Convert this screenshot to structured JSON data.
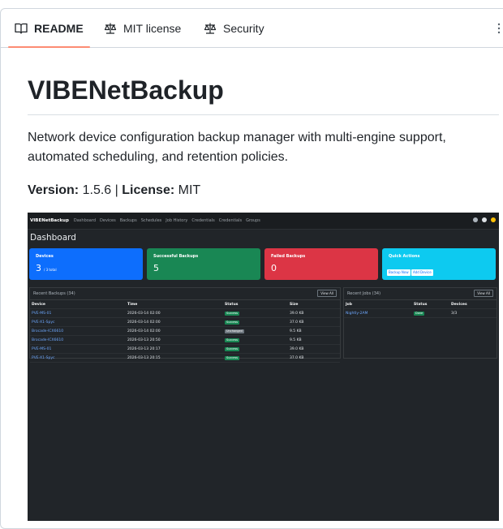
{
  "tabs": [
    {
      "label": "README",
      "icon": "book-icon",
      "active": true
    },
    {
      "label": "MIT license",
      "icon": "scale-icon",
      "active": false
    },
    {
      "label": "Security",
      "icon": "scale-icon",
      "active": false
    }
  ],
  "readme": {
    "title": "VIBENetBackup",
    "description": "Network device configuration backup manager with multi-engine support, automated scheduling, and retention policies.",
    "version_label": "Version:",
    "version": "1.5.6",
    "separator": "|",
    "license_label": "License:",
    "license": "MIT"
  },
  "screenshot": {
    "brand": "VIBENetBackup",
    "nav": [
      "Dashboard",
      "Devices",
      "Backups",
      "Schedules",
      "Job History",
      "Credentials",
      "Credentials",
      "Groups"
    ],
    "page_title": "Dashboard",
    "cards": [
      {
        "title": "Devices",
        "value": "3",
        "sub": "/ 3 total",
        "color": "#0d6efd"
      },
      {
        "title": "Successful Backups",
        "value": "5",
        "color": "#198754"
      },
      {
        "title": "Failed Backups",
        "value": "0",
        "color": "#dc3545"
      },
      {
        "title": "Quick Actions",
        "color": "#0dcaf0",
        "buttons": [
          "Backup Now",
          "Add Device"
        ]
      }
    ],
    "recent_backups": {
      "title": "Recent Backups (34)",
      "view_all": "View All",
      "columns": [
        "Device",
        "Time",
        "Status",
        "Size"
      ],
      "rows": [
        {
          "device": "PVE-MS-01",
          "time": "2026-03-14 02:00",
          "status": "Success",
          "status_color": "#198754",
          "size": "39.0 KB"
        },
        {
          "device": "PVE-X1-Spyc",
          "time": "2026-03-14 02:00",
          "status": "Success",
          "status_color": "#198754",
          "size": "37.0 KB"
        },
        {
          "device": "Brocade-ICX6610",
          "time": "2026-03-14 02:00",
          "status": "Unchanged",
          "status_color": "#6c757d",
          "size": "9.5 KB"
        },
        {
          "device": "Brocade-ICX6610",
          "time": "2026-03-13 20:50",
          "status": "Success",
          "status_color": "#198754",
          "size": "9.5 KB"
        },
        {
          "device": "PVE-MS-01",
          "time": "2026-03-13 20:17",
          "status": "Success",
          "status_color": "#198754",
          "size": "39.0 KB"
        },
        {
          "device": "PVE-X1-Spyc",
          "time": "2026-03-13 20:15",
          "status": "Success",
          "status_color": "#198754",
          "size": "37.0 KB"
        }
      ]
    },
    "recent_jobs": {
      "title": "Recent Jobs (34)",
      "view_all": "View All",
      "columns": [
        "Job",
        "Status",
        "Devices"
      ],
      "rows": [
        {
          "job": "Nightly-2AM",
          "status": "Done",
          "status_color": "#198754",
          "devices": "3/3"
        }
      ]
    }
  }
}
